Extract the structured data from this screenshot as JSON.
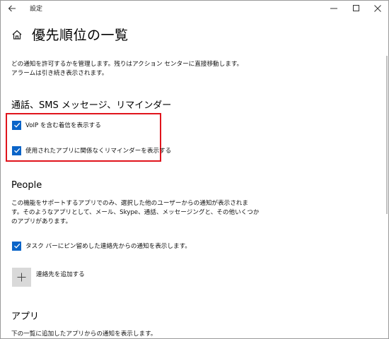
{
  "window": {
    "title": "設定",
    "back_icon": "arrow-left-icon",
    "minimize_icon": "minimize-icon",
    "maximize_icon": "maximize-icon",
    "close_icon": "close-icon"
  },
  "header": {
    "home_icon": "home-icon",
    "title": "優先順位の一覧"
  },
  "intro": {
    "line1": "どの通知を許可するかを管理します。残りはアクション センターに直接移動します。",
    "line2": "アラームは引き続き表示されます。"
  },
  "calls_section": {
    "title": "通話、SMS メッセージ、リマインダー",
    "voip_label": "VoIP を含む着信を表示する",
    "voip_checked": true,
    "reminders_label": "使用されたアプリに関係なくリマインダーを表示する",
    "reminders_checked": true,
    "highlight_color": "#e0141c"
  },
  "people_section": {
    "title": "People",
    "desc_line1": "この機能をサポートするアプリでのみ、選択した他のユーザーからの通知が表示されま",
    "desc_line2": "す。そのようなアプリとして、メール、Skype、通話、メッセージングと、その他いくつか",
    "desc_line3": "のアプリがあります。",
    "taskbar_label": "タスク バーにピン留めした連絡先からの通知を表示します。",
    "taskbar_checked": true,
    "add_contact_label": "連絡先を追加する"
  },
  "apps_section": {
    "title": "アプリ",
    "desc": "下の一覧に追加したアプリからの通知を表示します。"
  },
  "colors": {
    "accent": "#0a64c8",
    "add_button_bg": "#d9d9d9"
  }
}
